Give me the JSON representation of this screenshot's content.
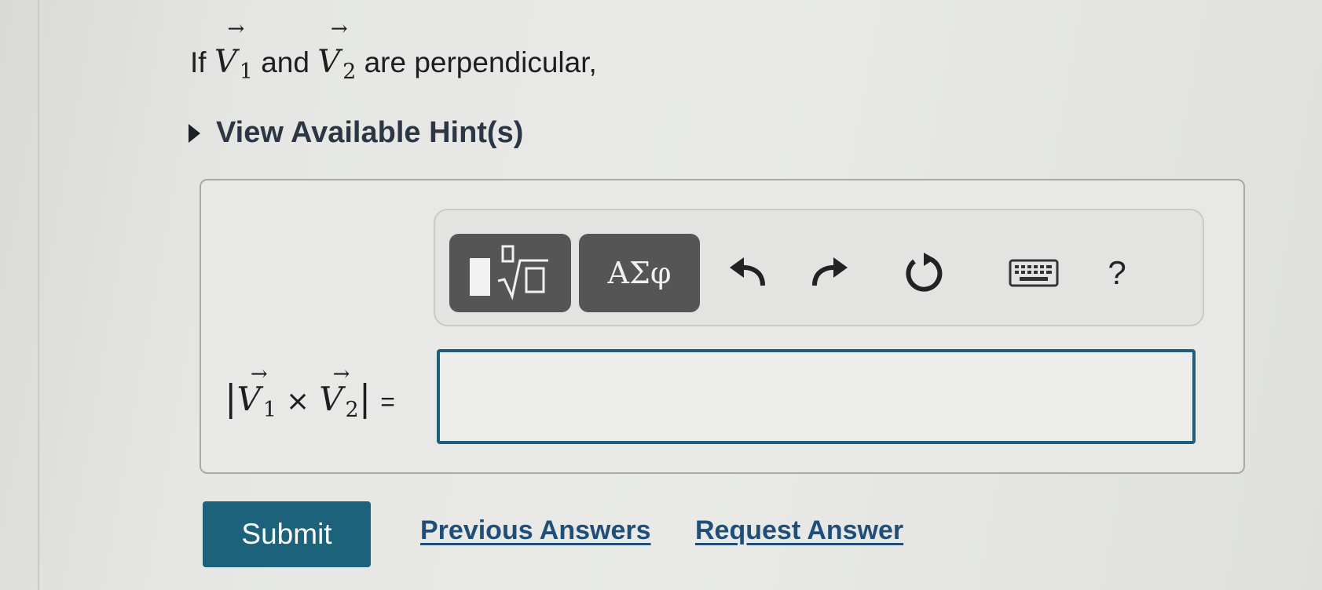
{
  "question": {
    "prefix": "If",
    "vector_1": "V",
    "sub_1": "1",
    "conjunction": "and",
    "vector_2": "V",
    "sub_2": "2",
    "suffix": "are perpendicular,"
  },
  "hint": {
    "label": "View Available Hint(s)"
  },
  "toolbar": {
    "greek_label": "ΑΣφ",
    "help_label": "?"
  },
  "expression": {
    "bar_open": "|",
    "vector_1": "V",
    "sub_1": "1",
    "operator": "×",
    "vector_2": "V",
    "sub_2": "2",
    "bar_close": "|",
    "equals": "="
  },
  "answer": {
    "value": ""
  },
  "actions": {
    "submit_label": "Submit",
    "previous_answers_label": "Previous Answers",
    "request_answer_label": "Request Answer"
  },
  "colors": {
    "accent": "#1d627b",
    "link": "#1f4f78",
    "toolbar_button": "#555555"
  }
}
